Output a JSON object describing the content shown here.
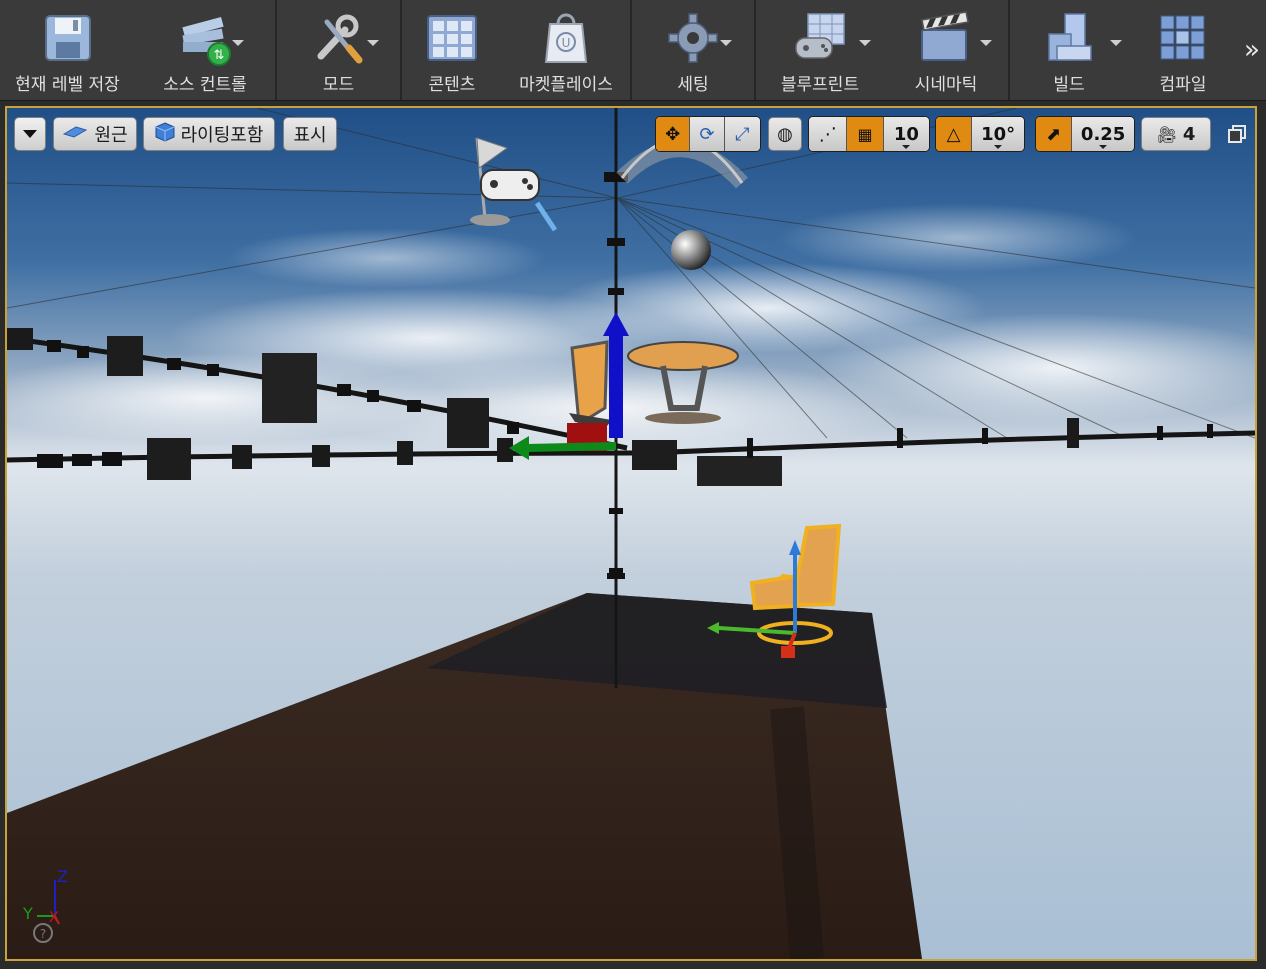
{
  "toolbar": {
    "buttons": [
      {
        "label": "현재 레벨 저장",
        "icon": "save-icon"
      },
      {
        "label": "소스 컨트롤",
        "icon": "source-control-icon"
      },
      {
        "label": "모드",
        "icon": "modes-icon"
      },
      {
        "label": "콘텐츠",
        "icon": "content-icon"
      },
      {
        "label": "마켓플레이스",
        "icon": "marketplace-icon"
      },
      {
        "label": "세팅",
        "icon": "settings-icon"
      },
      {
        "label": "블루프린트",
        "icon": "blueprint-icon"
      },
      {
        "label": "시네마틱",
        "icon": "cinematics-icon"
      },
      {
        "label": "빌드",
        "icon": "build-icon"
      },
      {
        "label": "컴파일",
        "icon": "compile-icon"
      }
    ],
    "more_icon": "double-chevron-right-icon"
  },
  "viewport": {
    "options_icon": "dropdown-arrow-icon",
    "view_mode": "원근",
    "lighting_mode": "라이팅포함",
    "show_label": "표시",
    "grid_snap": "10",
    "rotation_snap": "10°",
    "scale_snap": "0.25",
    "camera_speed": "4",
    "axis_labels": {
      "z": "Z",
      "y": "Y",
      "x": "X"
    }
  },
  "colors": {
    "accent": "#e08a12",
    "selection_outline": "#f0b020",
    "toolbar_bg": "#3a3a3a",
    "viewport_border": "#c8a23a"
  }
}
